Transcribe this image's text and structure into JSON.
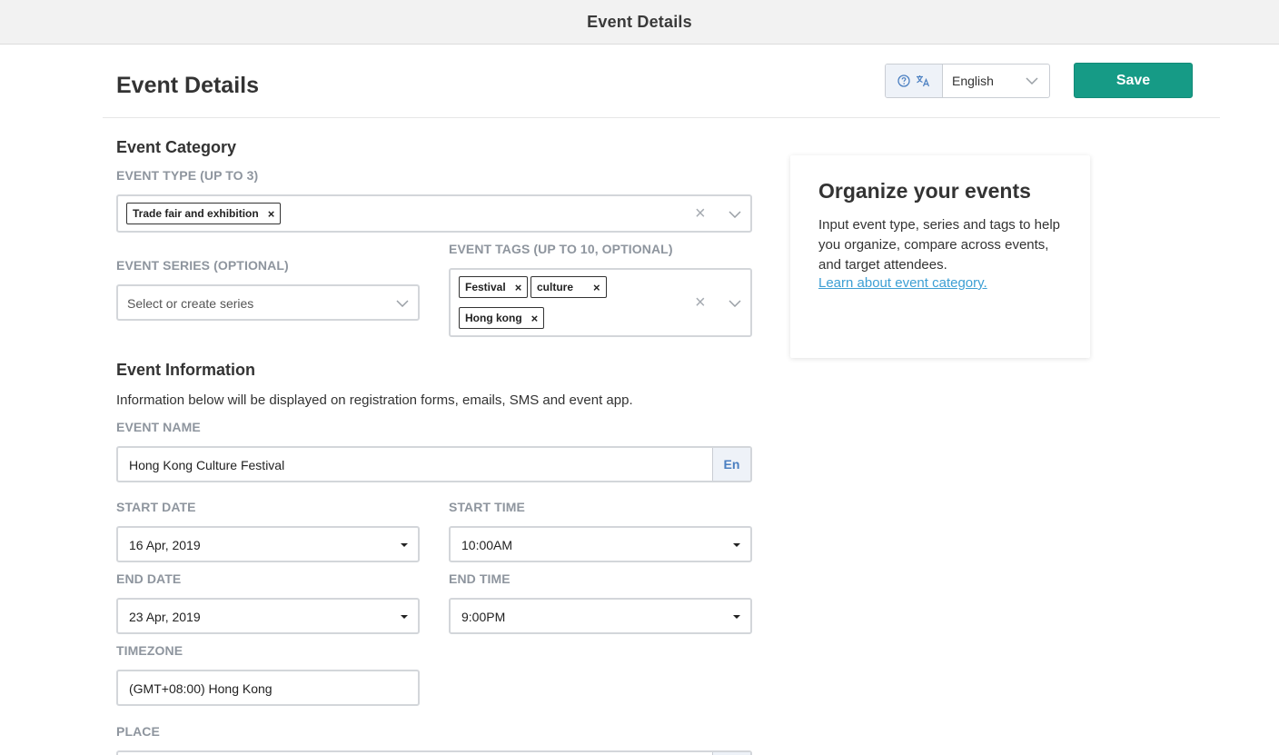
{
  "window": {
    "title": "Event Details"
  },
  "header": {
    "page_title": "Event Details",
    "language": {
      "selected": "English"
    },
    "save_label": "Save"
  },
  "category": {
    "title": "Event Category",
    "event_type": {
      "label": "EVENT TYPE (UP TO 3)",
      "tags": [
        "Trade fair and exhibition"
      ]
    },
    "event_series": {
      "label": "EVENT SERIES (OPTIONAL)",
      "placeholder": "Select or create series"
    },
    "event_tags": {
      "label": "EVENT TAGS (UP TO 10, OPTIONAL)",
      "tags": [
        "Festival",
        "culture",
        "Hong kong"
      ]
    }
  },
  "information": {
    "title": "Event Information",
    "description": "Information below will be displayed on registration forms, emails, SMS and event app.",
    "event_name": {
      "label": "EVENT NAME",
      "value": "Hong Kong Culture Festival",
      "lang": "En"
    },
    "start_date": {
      "label": "START DATE",
      "value": "16 Apr, 2019"
    },
    "start_time": {
      "label": "START TIME",
      "value": "10:00AM"
    },
    "end_date": {
      "label": "END DATE",
      "value": "23 Apr, 2019"
    },
    "end_time": {
      "label": "END TIME",
      "value": "9:00PM"
    },
    "timezone": {
      "label": "TIMEZONE",
      "value": "(GMT+08:00) Hong Kong"
    },
    "place": {
      "label": "PLACE"
    }
  },
  "sidebar_card": {
    "title": "Organize your events",
    "body": "Input event type, series and tags to help you organize, compare across events, and target attendees.",
    "link": "Learn about event category."
  },
  "colors": {
    "accent": "#169b86",
    "link": "#3d9fd4",
    "label": "#8e959e"
  },
  "icons": [
    "help-circle-icon",
    "translate-icon",
    "chevron-down-icon",
    "clear-icon",
    "remove-tag-icon",
    "caret-down-icon"
  ]
}
